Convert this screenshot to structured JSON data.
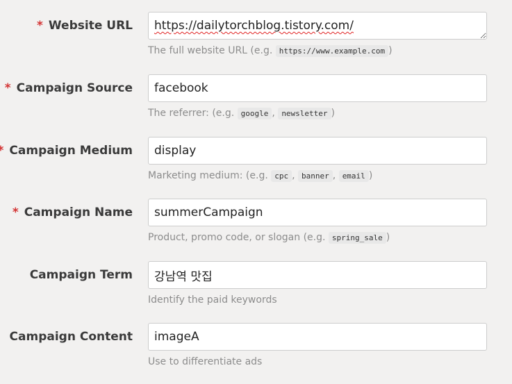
{
  "form": {
    "required_mark": "*",
    "fields": [
      {
        "label": "Website URL",
        "required": true,
        "value": "https://dailytorchblog.tistory.com/",
        "help_prefix": "The full website URL (e.g. ",
        "help_codes": [
          "https://www.example.com"
        ],
        "help_suffix": ")"
      },
      {
        "label": "Campaign Source",
        "required": true,
        "value": "facebook",
        "help_prefix": "The referrer: (e.g. ",
        "help_codes": [
          "google",
          "newsletter"
        ],
        "help_suffix": ")"
      },
      {
        "label": "Campaign Medium",
        "required": true,
        "value": "display",
        "help_prefix": "Marketing medium: (e.g. ",
        "help_codes": [
          "cpc",
          "banner",
          "email"
        ],
        "help_suffix": ")"
      },
      {
        "label": "Campaign Name",
        "required": true,
        "value": "summerCampaign",
        "help_prefix": "Product, promo code, or slogan (e.g. ",
        "help_codes": [
          "spring_sale"
        ],
        "help_suffix": ")"
      },
      {
        "label": "Campaign Term",
        "required": false,
        "value": "강남역 맛집",
        "help_text": "Identify the paid keywords"
      },
      {
        "label": "Campaign Content",
        "required": false,
        "value": "imageA",
        "help_text": "Use to differentiate ads"
      }
    ],
    "separator": ", "
  }
}
